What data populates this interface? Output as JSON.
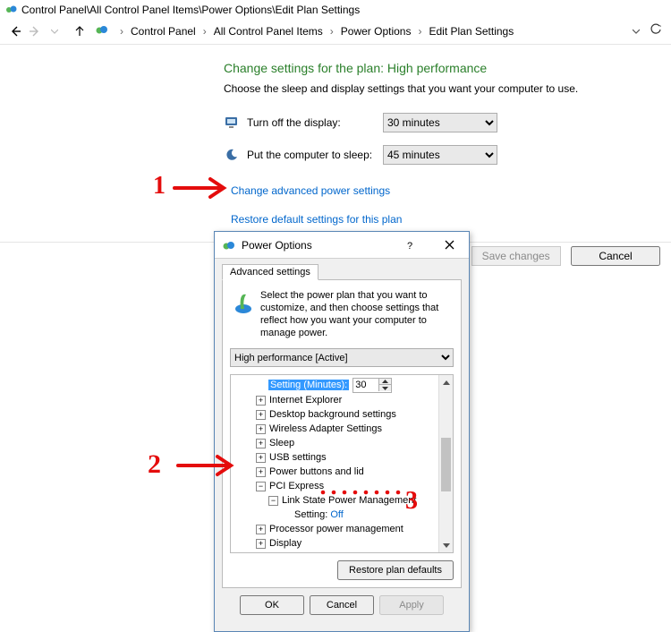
{
  "title": "Control Panel\\All Control Panel Items\\Power Options\\Edit Plan Settings",
  "breadcrumbs": {
    "items": [
      "Control Panel",
      "All Control Panel Items",
      "Power Options",
      "Edit Plan Settings"
    ]
  },
  "page": {
    "heading": "Change settings for the plan: High performance",
    "subtext": "Choose the sleep and display settings that you want your computer to use.",
    "display_label": "Turn off the display:",
    "display_value": "30 minutes",
    "sleep_label": "Put the computer to sleep:",
    "sleep_value": "45 minutes",
    "link_advanced": "Change advanced power settings",
    "link_restore": "Restore default settings for this plan",
    "save_btn": "Save changes",
    "cancel_btn": "Cancel"
  },
  "dialog": {
    "title": "Power Options",
    "tab": "Advanced settings",
    "intro": "Select the power plan that you want to customize, and then choose settings that reflect how you want your computer to manage power.",
    "plan_selected": "High performance [Active]",
    "spinner": {
      "label": "Setting (Minutes):",
      "value": "30"
    },
    "tree": {
      "ie": "Internet Explorer",
      "desktop": "Desktop background settings",
      "wifi": "Wireless Adapter Settings",
      "sleep": "Sleep",
      "usb": "USB settings",
      "power_buttons": "Power buttons and lid",
      "pci": "PCI Express",
      "linkstate": "Link State Power Management",
      "setting_label": "Setting:",
      "setting_value": "Off",
      "cpu": "Processor power management",
      "display": "Display"
    },
    "restore_btn": "Restore plan defaults",
    "ok_btn": "OK",
    "cancel_btn": "Cancel",
    "apply_btn": "Apply"
  },
  "annotations": {
    "one": "1",
    "two": "2",
    "three": "3"
  }
}
